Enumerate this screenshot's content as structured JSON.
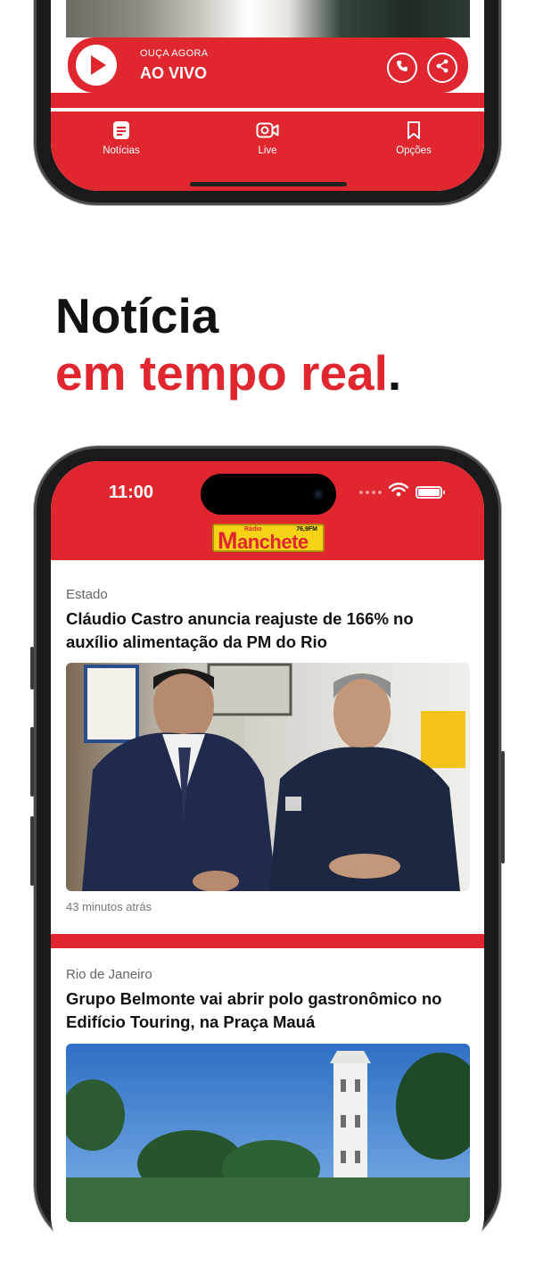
{
  "top_phone": {
    "live_player": {
      "kicker": "OUÇA AGORA",
      "title": "AO VIVO"
    },
    "tabs": [
      {
        "label": "Notícias",
        "icon": "news-icon"
      },
      {
        "label": "Live",
        "icon": "video-icon"
      },
      {
        "label": "Opções",
        "icon": "bookmark-icon"
      }
    ]
  },
  "headline": {
    "line1": "Notícia",
    "line2": "em tempo real",
    "period": "."
  },
  "bottom_phone": {
    "status_bar": {
      "time": "11:00"
    },
    "logo": {
      "radio": "Rádio",
      "name_initial": "M",
      "name_rest": "anchete",
      "frequency": "76,9FM"
    },
    "articles": [
      {
        "category": "Estado",
        "title": "Cláudio Castro anuncia reajuste de 166% no auxílio alimentação da PM do Rio",
        "time": "43 minutos atrás"
      },
      {
        "category": "Rio de Janeiro",
        "title": "Grupo Belmonte vai abrir polo gastronômico no Edifício Touring, na Praça Mauá"
      }
    ]
  },
  "colors": {
    "brand_red": "#e0272f",
    "logo_yellow": "#f7d317",
    "text_dark": "#111111",
    "text_muted": "#666666"
  }
}
